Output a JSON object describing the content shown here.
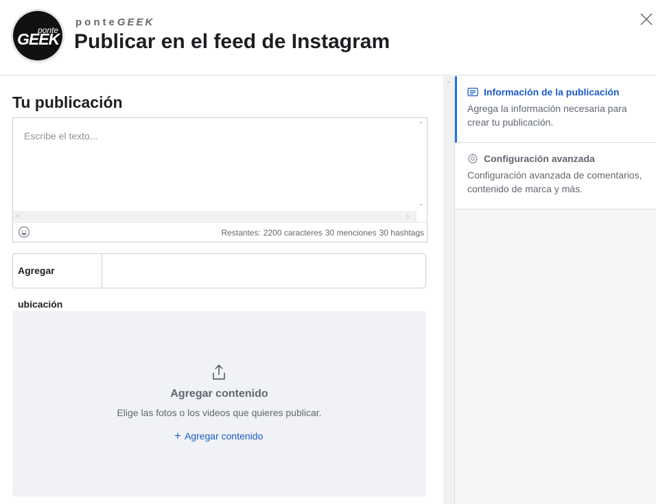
{
  "header": {
    "brand_light": "ponte",
    "brand_bold": "GEEK",
    "logo_small": "ponte",
    "logo_big": "GEEK",
    "title": "Publicar en el feed de Instagram"
  },
  "post": {
    "section_title": "Tu publicación",
    "text_placeholder": "Escribe el texto...",
    "counter_prefix": "Restantes:",
    "chars_remaining": "2200 caracteres",
    "mentions_remaining": "30 menciones",
    "hashtags_remaining": "30 hashtags",
    "location_label": "Agregar ubicación",
    "location_value": ""
  },
  "dropzone": {
    "title": "Agregar contenido",
    "description": "Elige las fotos o los videos que quieres publicar.",
    "link_label": "Agregar contenido"
  },
  "steps": [
    {
      "title": "Información de la publicación",
      "description": "Agrega la información necesaria para crear tu publicación.",
      "active": true
    },
    {
      "title": "Configuración avanzada",
      "description": "Configuración avanzada de comentarios, contenido de marca y más.",
      "active": false
    }
  ],
  "colors": {
    "accent": "#1b74e4",
    "link": "#1b5bc4",
    "text_secondary": "#606770",
    "dropzone_bg": "#f0f2f5"
  },
  "icons": [
    "close-icon",
    "emoji-icon",
    "upload-icon",
    "plus-icon",
    "document-icon",
    "gear-icon"
  ]
}
